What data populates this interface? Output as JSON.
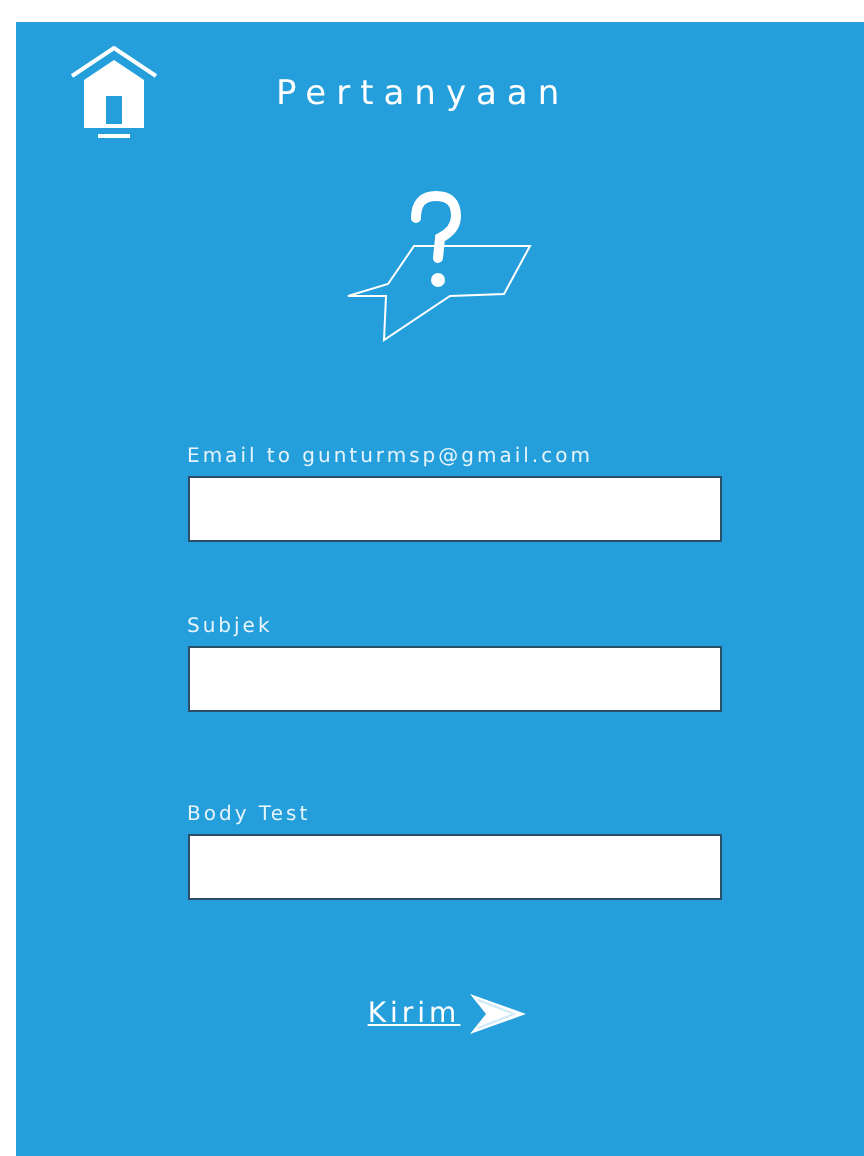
{
  "header": {
    "title": "Pertanyaan"
  },
  "fields": [
    {
      "label": "Email to gunturmsp@gmail.com"
    },
    {
      "label": "Subjek"
    },
    {
      "label": "Body Test"
    }
  ],
  "submit": {
    "label": "Kirim"
  }
}
